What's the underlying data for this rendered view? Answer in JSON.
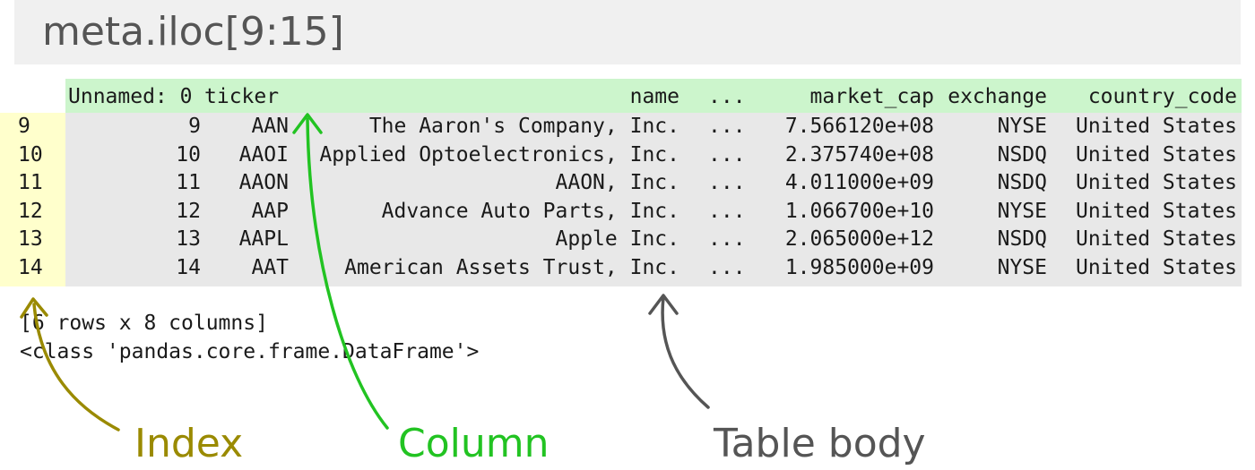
{
  "code_cell": {
    "text": "meta.iloc[9:15]"
  },
  "table": {
    "columns": [
      "Unnamed: 0",
      "ticker",
      "name",
      "...",
      "market_cap",
      "exchange",
      "country_code"
    ],
    "index": [
      "9",
      "10",
      "11",
      "12",
      "13",
      "14"
    ],
    "rows": [
      [
        "9",
        "AAN",
        "The Aaron's Company, Inc.",
        "...",
        "7.566120e+08",
        "NYSE",
        "United States"
      ],
      [
        "10",
        "AAOI",
        "Applied Optoelectronics, Inc.",
        "...",
        "2.375740e+08",
        "NSDQ",
        "United States"
      ],
      [
        "11",
        "AAON",
        "AAON, Inc.",
        "...",
        "4.011000e+09",
        "NSDQ",
        "United States"
      ],
      [
        "12",
        "AAP",
        "Advance Auto Parts, Inc.",
        "...",
        "1.066700e+10",
        "NYSE",
        "United States"
      ],
      [
        "13",
        "AAPL",
        "Apple Inc.",
        "...",
        "2.065000e+12",
        "NSDQ",
        "United States"
      ],
      [
        "14",
        "AAT",
        "American Assets Trust, Inc.",
        "...",
        "1.985000e+09",
        "NYSE",
        "United States"
      ]
    ]
  },
  "footer": {
    "shape": "[6 rows x 8 columns]",
    "type": "<class 'pandas.core.frame.DataFrame'>"
  },
  "annotations": {
    "index": {
      "label": "Index",
      "color": "#9a8a00"
    },
    "column": {
      "label": "Column",
      "color": "#22c322"
    },
    "body": {
      "label": "Table body",
      "color": "#555555"
    }
  },
  "colors": {
    "header_bg": "#ccf5cc",
    "index_bg": "#ffffcc",
    "body_bg": "#e8e8e8",
    "code_bg": "#f0f0f0"
  }
}
